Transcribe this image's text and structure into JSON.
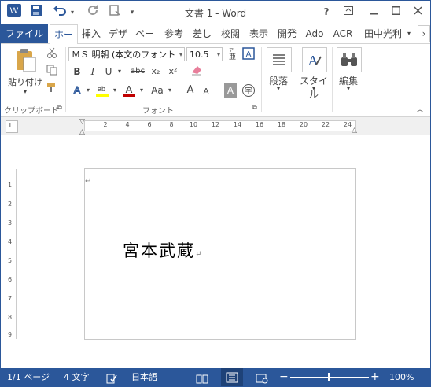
{
  "title": "文書 1 - Word",
  "quick_access": {
    "app_icon": "W",
    "save_icon": "save-icon",
    "undo_icon": "undo-icon",
    "redo_icon": "redo-icon",
    "customize_icon": "chevron-down-icon"
  },
  "window_controls": {
    "help": "?",
    "ribbon_display": "⊡",
    "minimize": "—",
    "maximize": "☐",
    "close": "✕"
  },
  "tabs": {
    "file": "ファイル",
    "items": [
      "ホー",
      "挿入",
      "デザ",
      "ペー",
      "参考",
      "差し",
      "校閲",
      "表示",
      "開発",
      "Ado",
      "ACR"
    ],
    "user": "田中光利"
  },
  "ribbon": {
    "clipboard": {
      "paste": "貼り付け",
      "group": "クリップボード"
    },
    "font": {
      "font_name": "ＭＳ 明朝 (本文のフォント",
      "font_size": "10.5",
      "group": "フォント",
      "bold": "B",
      "italic": "I",
      "underline": "U",
      "strike": "abc",
      "subscript": "x₂",
      "superscript": "x²",
      "case": "Aa",
      "grow": "A",
      "shrink": "A",
      "char_shade": "A",
      "enclose": "字",
      "phonetic": "亜"
    },
    "paragraph": {
      "label": "段落"
    },
    "styles": {
      "label": "スタイル"
    },
    "editing": {
      "label": "編集"
    }
  },
  "ruler": {
    "h_ticks": [
      "2",
      "4",
      "6",
      "8",
      "10",
      "12",
      "14",
      "16",
      "18",
      "20",
      "22",
      "24"
    ],
    "v_ticks": [
      "1",
      "2",
      "3",
      "4",
      "5",
      "6",
      "7",
      "8",
      "9"
    ]
  },
  "document": {
    "text": "宮本武蔵"
  },
  "status": {
    "page": "1/1 ページ",
    "words": "4 文字",
    "language": "日本語",
    "zoom": "100%"
  },
  "colors": {
    "accent": "#2b579a",
    "highlight": "#ffff00",
    "font_color": "#c00000"
  }
}
